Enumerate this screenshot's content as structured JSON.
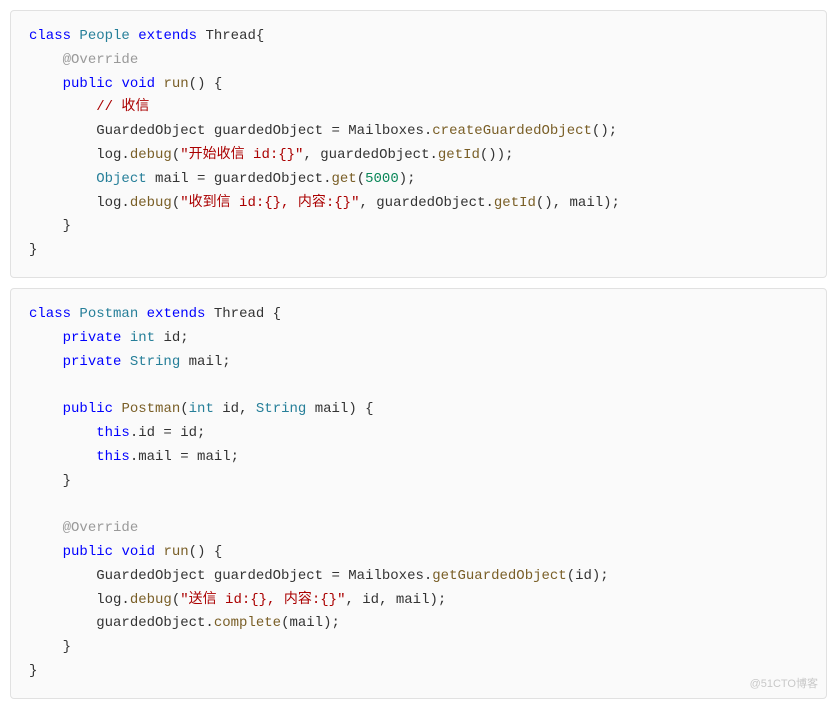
{
  "block1": {
    "l1_class": "class",
    "l1_name": "People",
    "l1_extends": "extends",
    "l1_thread": "Thread{",
    "l2_anno": "@Override",
    "l3_public": "public",
    "l3_void": "void",
    "l3_run": "run",
    "l3_rest": "() {",
    "l4_comment": "// 收信",
    "l5_a": "GuardedObject guardedObject = Mailboxes.",
    "l5_m": "createGuardedObject",
    "l5_b": "();",
    "l6_a": "log.",
    "l6_m": "debug",
    "l6_b": "(",
    "l6_str": "\"开始收信 id:{}\"",
    "l6_c": ", guardedObject.",
    "l6_m2": "getId",
    "l6_d": "());",
    "l7_type": "Object",
    "l7_a": " mail = guardedObject.",
    "l7_m": "get",
    "l7_b": "(",
    "l7_num": "5000",
    "l7_c": ");",
    "l8_a": "log.",
    "l8_m": "debug",
    "l8_b": "(",
    "l8_str": "\"收到信 id:{}, 内容:{}\"",
    "l8_c": ", guardedObject.",
    "l8_m2": "getId",
    "l8_d": "(), mail);",
    "l9": "}",
    "l10": "}"
  },
  "block2": {
    "l1_class": "class",
    "l1_name": "Postman",
    "l1_extends": "extends",
    "l1_thread": "Thread {",
    "l2_priv": "private",
    "l2_int": "int",
    "l2_rest": " id;",
    "l3_priv": "private",
    "l3_str": "String",
    "l3_rest": " mail;",
    "l4_public": "public",
    "l4_name": "Postman",
    "l4_a": "(",
    "l4_int": "int",
    "l4_b": " id, ",
    "l4_strt": "String",
    "l4_c": " mail) {",
    "l5_this": "this",
    "l5_a": ".id = id;",
    "l6_this": "this",
    "l6_a": ".mail = mail;",
    "l7": "}",
    "l8_anno": "@Override",
    "l9_public": "public",
    "l9_void": "void",
    "l9_run": "run",
    "l9_rest": "() {",
    "l10_a": "GuardedObject guardedObject = Mailboxes.",
    "l10_m": "getGuardedObject",
    "l10_b": "(id);",
    "l11_a": "log.",
    "l11_m": "debug",
    "l11_b": "(",
    "l11_str": "\"送信 id:{}, 内容:{}\"",
    "l11_c": ", id, mail);",
    "l12_a": "guardedObject.",
    "l12_m": "complete",
    "l12_b": "(mail);",
    "l13": "}",
    "l14": "}"
  },
  "watermark": "@51CTO博客"
}
